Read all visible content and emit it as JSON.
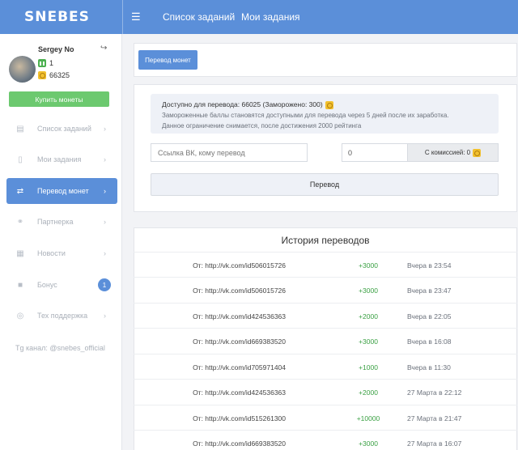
{
  "header": {
    "logo": "SNEBES",
    "nav": [
      "Список заданий",
      "Мои задания"
    ]
  },
  "user": {
    "name": "Sergey No",
    "rating": "1",
    "balance": "66325",
    "buy_label": "Купить монеты"
  },
  "sidebar": {
    "items": [
      {
        "label": "Список заданий",
        "icon": "list-icon"
      },
      {
        "label": "Мои задания",
        "icon": "document-icon"
      },
      {
        "label": "Перевод монет",
        "icon": "transfer-icon"
      },
      {
        "label": "Партнерка",
        "icon": "handshake-icon"
      },
      {
        "label": "Новости",
        "icon": "news-icon"
      },
      {
        "label": "Бонус",
        "icon": "gift-icon",
        "badge": "1"
      },
      {
        "label": "Тех поддержка",
        "icon": "support-icon"
      }
    ],
    "telegram": "Tg канал: @snebes_official"
  },
  "transfer": {
    "tab_label": "Перевод монет",
    "available": "Доступно для перевода: 66025 (Заморожено: 300)",
    "note1": "Замороженные баллы становятся доступными для перевода через 5 дней после их заработка.",
    "note2": "Данное ограничение снимается, после достижения 2000 рейтинга",
    "vk_placeholder": "Ссылка ВК, кому перевод",
    "amount_value": "0",
    "commission_label": "С комиссией: 0",
    "submit_label": "Перевод"
  },
  "history": {
    "title": "История переводов",
    "rows": [
      {
        "from": "От: http://vk.com/id506015726",
        "amount": "+3000",
        "date": "Вчера в 23:54"
      },
      {
        "from": "От: http://vk.com/id506015726",
        "amount": "+3000",
        "date": "Вчера в 23:47"
      },
      {
        "from": "От: http://vk.com/id424536363",
        "amount": "+2000",
        "date": "Вчера в 22:05"
      },
      {
        "from": "От: http://vk.com/id669383520",
        "amount": "+3000",
        "date": "Вчера в 16:08"
      },
      {
        "from": "От: http://vk.com/id705971404",
        "amount": "+1000",
        "date": "Вчера в 11:30"
      },
      {
        "from": "От: http://vk.com/id424536363",
        "amount": "+2000",
        "date": "27 Марта в 22:12"
      },
      {
        "from": "От: http://vk.com/id515261300",
        "amount": "+10000",
        "date": "27 Марта в 21:47"
      },
      {
        "from": "От: http://vk.com/id669383520",
        "amount": "+3000",
        "date": "27 Марта в 16:07"
      }
    ]
  },
  "colors": {
    "primary": "#5b8fd9",
    "success": "#3aa043",
    "buy_button": "#6cc96f"
  }
}
